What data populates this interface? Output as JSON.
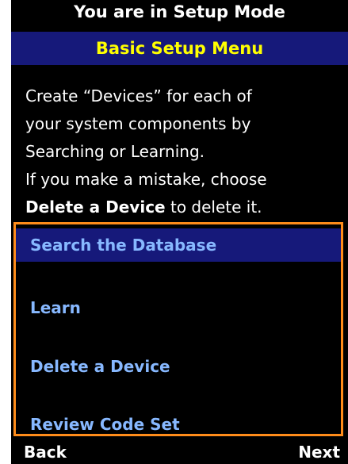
{
  "header": {
    "mode_title": "You are in Setup Mode",
    "menu_title": "Basic Setup Menu"
  },
  "instructions": {
    "line1": "Create “Devices” for each of",
    "line2": "your system components by",
    "line3": "Searching or Learning.",
    "line4": "If you make a mistake, choose",
    "line5_bold": "Delete a Device",
    "line5_rest": " to delete it."
  },
  "menu": {
    "items": [
      {
        "label": "Search the Database",
        "selected": true
      },
      {
        "label": "Learn",
        "selected": false
      },
      {
        "label": "Delete a Device",
        "selected": false
      },
      {
        "label": "Review Code Set",
        "selected": false
      }
    ]
  },
  "softkeys": {
    "left": "Back",
    "right": "Next"
  },
  "colors": {
    "background": "#000000",
    "title_bar": "#16197a",
    "title_text": "#ffff00",
    "menu_text": "#87b8ff",
    "highlight_border": "#ff8c1a"
  }
}
